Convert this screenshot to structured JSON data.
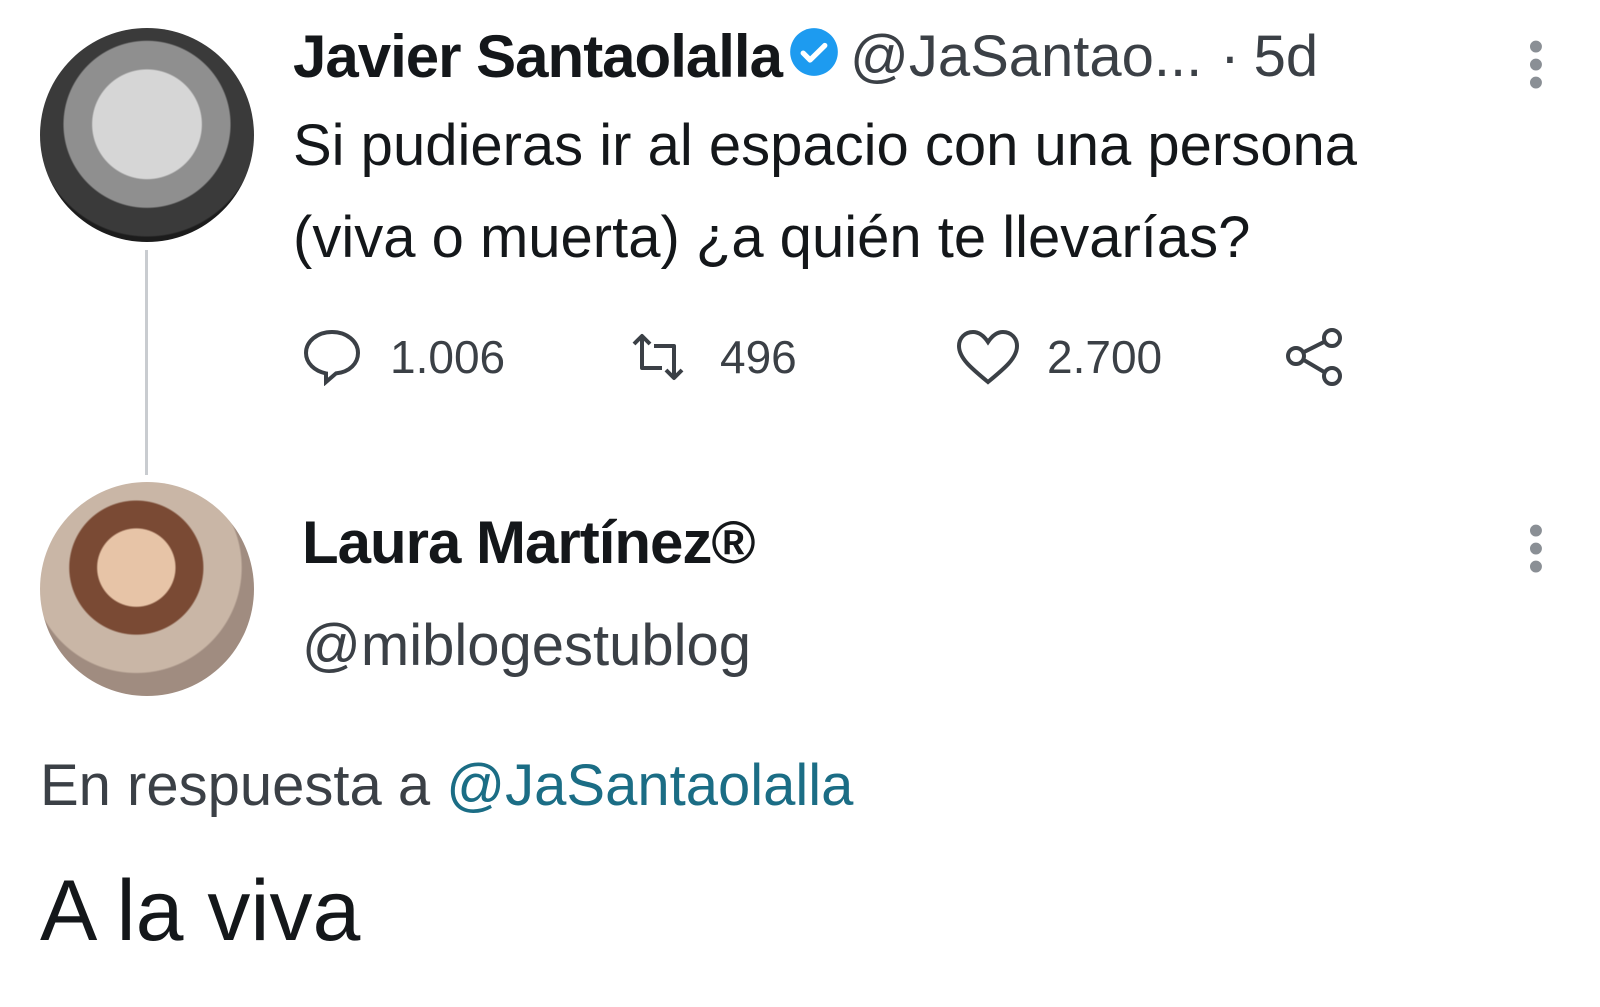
{
  "tweet": {
    "author_name": "Javier Santaolalla",
    "author_handle": "@JaSantao...",
    "separator": "·",
    "time": "5d",
    "text_line1": "Si pudieras ir al espacio con una persona",
    "text_line2": "(viva o muerta) ¿a quién te llevarías?",
    "stats": {
      "replies": "1.006",
      "retweets": "496",
      "likes": "2.700"
    }
  },
  "reply": {
    "author_name": "Laura Martínez®",
    "author_handle": "@miblogestublog",
    "in_reply_prefix": "En respuesta a ",
    "in_reply_handle": "@JaSantaolalla",
    "text": "A la viva"
  },
  "colors": {
    "verified": "#1d9bf0",
    "link": "#1b6d85",
    "text": "#14171a",
    "secondary": "#3b4046"
  },
  "icons": [
    "verified-icon",
    "more-icon",
    "reply-icon",
    "retweet-icon",
    "like-icon",
    "share-icon"
  ]
}
